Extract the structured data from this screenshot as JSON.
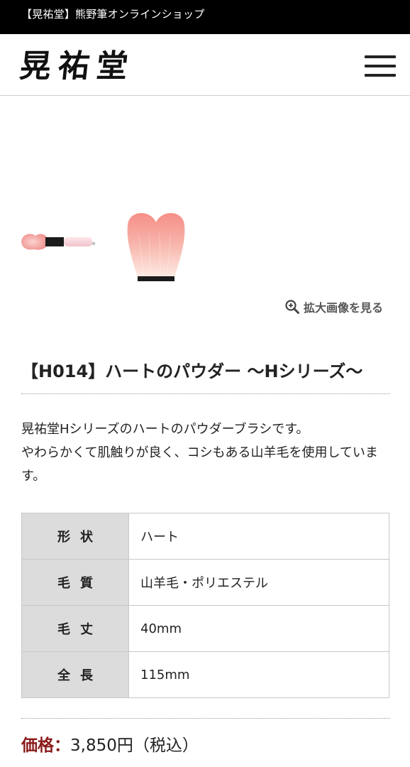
{
  "topbar": {
    "text": "【晃祐堂】熊野筆オンラインショップ"
  },
  "header": {
    "logo_text": "晃祐堂",
    "menu_icon": "hamburger-menu-icon"
  },
  "gallery": {
    "thumbnails": [
      "brush-side-view",
      "brush-head-closeup"
    ],
    "zoom_icon": "zoom-in-icon",
    "zoom_label": "拡大画像を見る"
  },
  "product": {
    "title": "【H014】ハートのパウダー ～Hシリーズ～",
    "description_line1": "晃祐堂Hシリーズのハートのパウダーブラシです。",
    "description_line2": "やわらかくて肌触りが良く、コシもある山羊毛を使用しています。",
    "specs": [
      {
        "key": "形状",
        "value": "ハート"
      },
      {
        "key": "毛質",
        "value": "山羊毛・ポリエステル"
      },
      {
        "key": "毛丈",
        "value": "40mm"
      },
      {
        "key": "全長",
        "value": "115mm"
      }
    ],
    "price_label": "価格：",
    "price_value": "3,850円（税込）"
  },
  "colors": {
    "topbar_bg": "#000000",
    "price_label": "#8b1a1a",
    "brush_pink": "#f4a3a0",
    "table_key_bg": "#dcdcdc"
  }
}
